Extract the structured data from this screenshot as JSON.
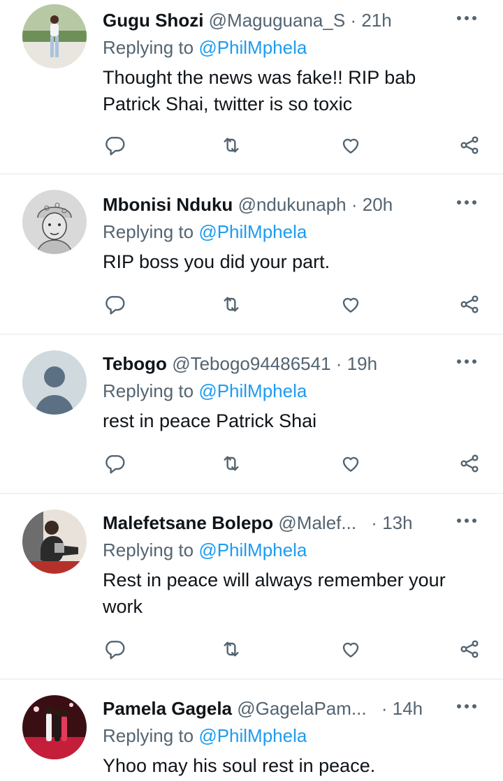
{
  "tweets": [
    {
      "name": "Gugu Shozi",
      "handle": "@Maguguana_S",
      "separator": "·",
      "time": "21h",
      "replying_prefix": "Replying to",
      "replying_to": "@PhilMphela",
      "text": "Thought the news was fake!! RIP bab Patrick Shai, twitter is so toxic",
      "avatar": "photo-woman-standing"
    },
    {
      "name": "Mbonisi Nduku",
      "handle": "@ndukunaph",
      "separator": "·",
      "time": "20h",
      "replying_prefix": "Replying to",
      "replying_to": "@PhilMphela",
      "text": "RIP boss you did your part.",
      "avatar": "sketch-portrait"
    },
    {
      "name": "Tebogo",
      "handle": "@Tebogo94486541",
      "separator": "·",
      "time": "19h",
      "replying_prefix": "Replying to",
      "replying_to": "@PhilMphela",
      "text": "rest in peace Patrick Shai",
      "avatar": "default-avatar"
    },
    {
      "name": "Malefetsane Bolepo",
      "handle": "@Malef...",
      "separator": "·",
      "time": "13h",
      "replying_prefix": "Replying to",
      "replying_to": "@PhilMphela",
      "text": "Rest in peace will always remember your work",
      "avatar": "photo-man-seated"
    },
    {
      "name": "Pamela Gagela",
      "handle": "@GagelaPam...",
      "separator": "·",
      "time": "14h",
      "replying_prefix": "Replying to",
      "replying_to": "@PhilMphela",
      "text": "Yhoo may his soul rest in peace.",
      "avatar": "photo-group-event"
    }
  ],
  "colors": {
    "text_primary": "#0f1419",
    "text_secondary": "#536471",
    "link": "#1d9bf0",
    "divider": "#eff3f4"
  },
  "icons": [
    "reply-icon",
    "retweet-icon",
    "like-icon",
    "share-icon",
    "more-icon"
  ]
}
